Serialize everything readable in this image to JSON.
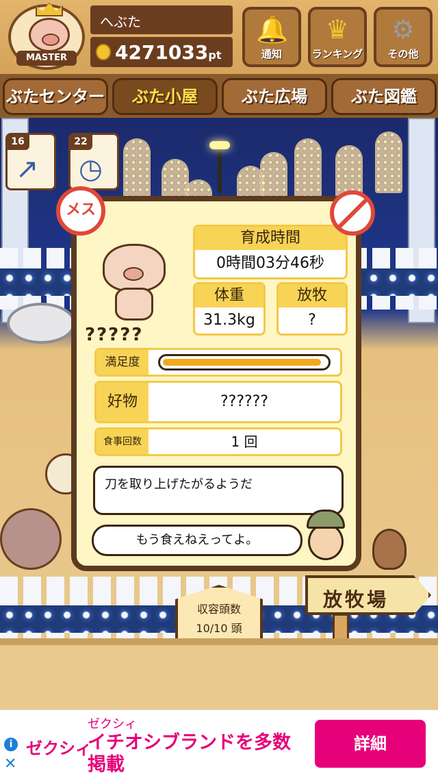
{
  "header": {
    "avatar_badge": "MASTER",
    "user_name": "へぶた",
    "points": "4271033",
    "points_unit": "pt",
    "buttons": [
      {
        "label": "通知",
        "icon": "bell-icon"
      },
      {
        "label": "ランキング",
        "icon": "crown-icon"
      },
      {
        "label": "その他",
        "icon": "gear-icon"
      }
    ]
  },
  "tabs": [
    {
      "label": "ぶたセンター",
      "active": false
    },
    {
      "label": "ぶた小屋",
      "active": true
    },
    {
      "label": "ぶた広場",
      "active": false
    },
    {
      "label": "ぶた図鑑",
      "active": false
    }
  ],
  "tools": [
    {
      "count": "16",
      "icon": "syringe-icon"
    },
    {
      "count": "22",
      "icon": "stopwatch-icon"
    }
  ],
  "pig_card": {
    "gender_label": "メス",
    "name": "?????",
    "growth_time_label": "育成時間",
    "growth_time_value": "0時間03分46秒",
    "weight_label": "体重",
    "weight_value": "31.3kg",
    "grazing_label": "放牧",
    "grazing_value": "?",
    "satisfaction_label": "満足度",
    "satisfaction_fraction": 0.97,
    "favorite_label": "好物",
    "favorite_value": "??????",
    "meals_label": "食事回数",
    "meals_value": "1 回",
    "message": "刀を取り上げたがるようだ",
    "farmer_speech": "もう食えねえってよ。"
  },
  "capacity": {
    "label": "収容頭数",
    "value": "10/10 頭"
  },
  "pasture_sign": "放牧場",
  "food_items": [
    {
      "icon": "grain-pile-icon"
    },
    {
      "icon": "soybean-pile-icon"
    },
    {
      "icon": "sweet-potato-icon"
    },
    {
      "icon": "corn-icon"
    },
    {
      "icon": "vegetable-leaf-icon"
    },
    {
      "icon": "acorn-icon"
    },
    {
      "icon": "grain-plate-icon"
    },
    {
      "icon": "meatball-plate-icon"
    }
  ],
  "ad": {
    "logo": "ゼクシィ",
    "brand": "ゼクシィ",
    "text": "イチオシブランドを多数掲載",
    "button": "詳細",
    "close": "✕",
    "info": "i"
  },
  "colors": {
    "accent": "#e6007a",
    "wood": "#6b3d1f",
    "card": "#fef6c5",
    "stat_header": "#f7d455",
    "bar": "#f2a91c"
  }
}
